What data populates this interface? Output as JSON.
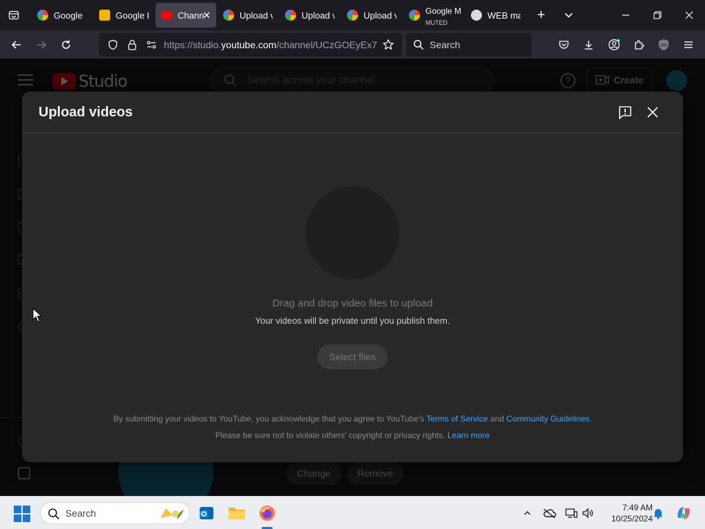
{
  "browser": {
    "tabs": [
      {
        "label": "Google",
        "sub": "",
        "active": false,
        "icon": "google-icon"
      },
      {
        "label": "Google K",
        "sub": "",
        "active": false,
        "icon": "keep-icon"
      },
      {
        "label": "Chann",
        "sub": "",
        "active": true,
        "icon": "youtube-icon"
      },
      {
        "label": "Upload v",
        "sub": "",
        "active": false,
        "icon": "google-icon"
      },
      {
        "label": "Upload v",
        "sub": "",
        "active": false,
        "icon": "google-icon"
      },
      {
        "label": "Upload v",
        "sub": "",
        "active": false,
        "icon": "google-icon"
      },
      {
        "label": "Google M",
        "sub": "MUTED",
        "active": false,
        "icon": "google-icon"
      },
      {
        "label": "WEB mac",
        "sub": "",
        "active": false,
        "icon": "eye-icon"
      }
    ],
    "url_prefix": "https://studio.",
    "url_host": "youtube.com",
    "url_path": "/channel/UCzGOEyEx7",
    "search_placeholder": "Search"
  },
  "studio": {
    "logo_text": "Studio",
    "search_placeholder": "Search across your channel",
    "create_label": "Create",
    "help_glyph": "?",
    "change_label": "Change",
    "remove_label": "Remove"
  },
  "dialog": {
    "title": "Upload videos",
    "drag_text": "Drag and drop video files to upload",
    "private_text": "Your videos will be private until you publish them.",
    "select_button": "Select files",
    "legal_line1_before": "By submitting your videos to YouTube, you acknowledge that you agree to YouTube's ",
    "terms_link": "Terms of Service",
    "legal_and": " and ",
    "guidelines_link": "Community Guidelines",
    "legal_period": ".",
    "legal_line2": "Please be sure not to violate others' copyright or privacy rights. ",
    "learn_more_link": "Learn more"
  },
  "taskbar": {
    "search_placeholder": "Search",
    "time": "7:49 AM",
    "date": "10/25/2024"
  },
  "colors": {
    "accent_link": "#3ea6ff",
    "youtube_red": "#cc0000",
    "windows_blue": "#1976d2"
  }
}
